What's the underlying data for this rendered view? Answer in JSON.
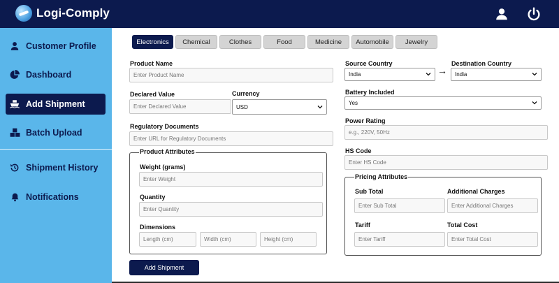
{
  "app": {
    "title": "Logi-Comply"
  },
  "colors": {
    "navy": "#0c1a4e",
    "sidebar": "#5ab6ea",
    "tab_inactive": "#d4d4d4"
  },
  "header": {
    "icons": [
      "user-icon",
      "power-icon"
    ]
  },
  "sidebar": {
    "items": [
      {
        "label": "Customer Profile",
        "icon": "user-icon"
      },
      {
        "label": "Dashboard",
        "icon": "pie-chart-icon"
      },
      {
        "label": "Add Shipment",
        "icon": "ship-icon",
        "active": true
      },
      {
        "label": "Batch Upload",
        "icon": "boxes-icon"
      },
      {
        "label": "Shipment History",
        "icon": "history-icon"
      },
      {
        "label": "Notifications",
        "icon": "bell-icon"
      }
    ]
  },
  "tabs": [
    "Electronics",
    "Chemical",
    "Clothes",
    "Food",
    "Medicine",
    "Automobile",
    "Jewelry"
  ],
  "form": {
    "product_name": {
      "label": "Product Name",
      "placeholder": "Enter Product Name"
    },
    "declared_value": {
      "label": "Declared Value",
      "placeholder": "Enter Declared Value"
    },
    "currency": {
      "label": "Currency",
      "value": "USD"
    },
    "regulatory_documents": {
      "label": "Regulatory Documents",
      "placeholder": "Enter URL for Regulatory Documents"
    },
    "product_attributes": {
      "legend": "Product Attributes",
      "weight": {
        "label": "Weight (grams)",
        "placeholder": "Enter Weight"
      },
      "quantity": {
        "label": "Quantity",
        "placeholder": "Enter Quantity"
      },
      "dimensions": {
        "label": "Dimensions",
        "length": "Length (cm)",
        "width": "Width (cm)",
        "height": "Height (cm)"
      }
    },
    "source_country": {
      "label": "Source Country",
      "value": "India"
    },
    "destination_country": {
      "label": "Destination Country",
      "value": "India"
    },
    "arrow": "→",
    "battery_included": {
      "label": "Battery Included",
      "value": "Yes"
    },
    "power_rating": {
      "label": "Power Rating",
      "placeholder": "e.g., 220V, 50Hz"
    },
    "hs_code": {
      "label": "HS Code",
      "placeholder": "Enter HS Code"
    },
    "pricing_attributes": {
      "legend": "Pricing Attributes",
      "sub_total": {
        "label": "Sub Total",
        "placeholder": "Enter Sub Total"
      },
      "additional_charges": {
        "label": "Additional Charges",
        "placeholder": "Enter Additional Charges"
      },
      "tariff": {
        "label": "Tariff",
        "placeholder": "Enter Tariff"
      },
      "total_cost": {
        "label": "Total Cost",
        "placeholder": "Enter Total Cost"
      }
    },
    "submit_label": "Add Shipment"
  }
}
